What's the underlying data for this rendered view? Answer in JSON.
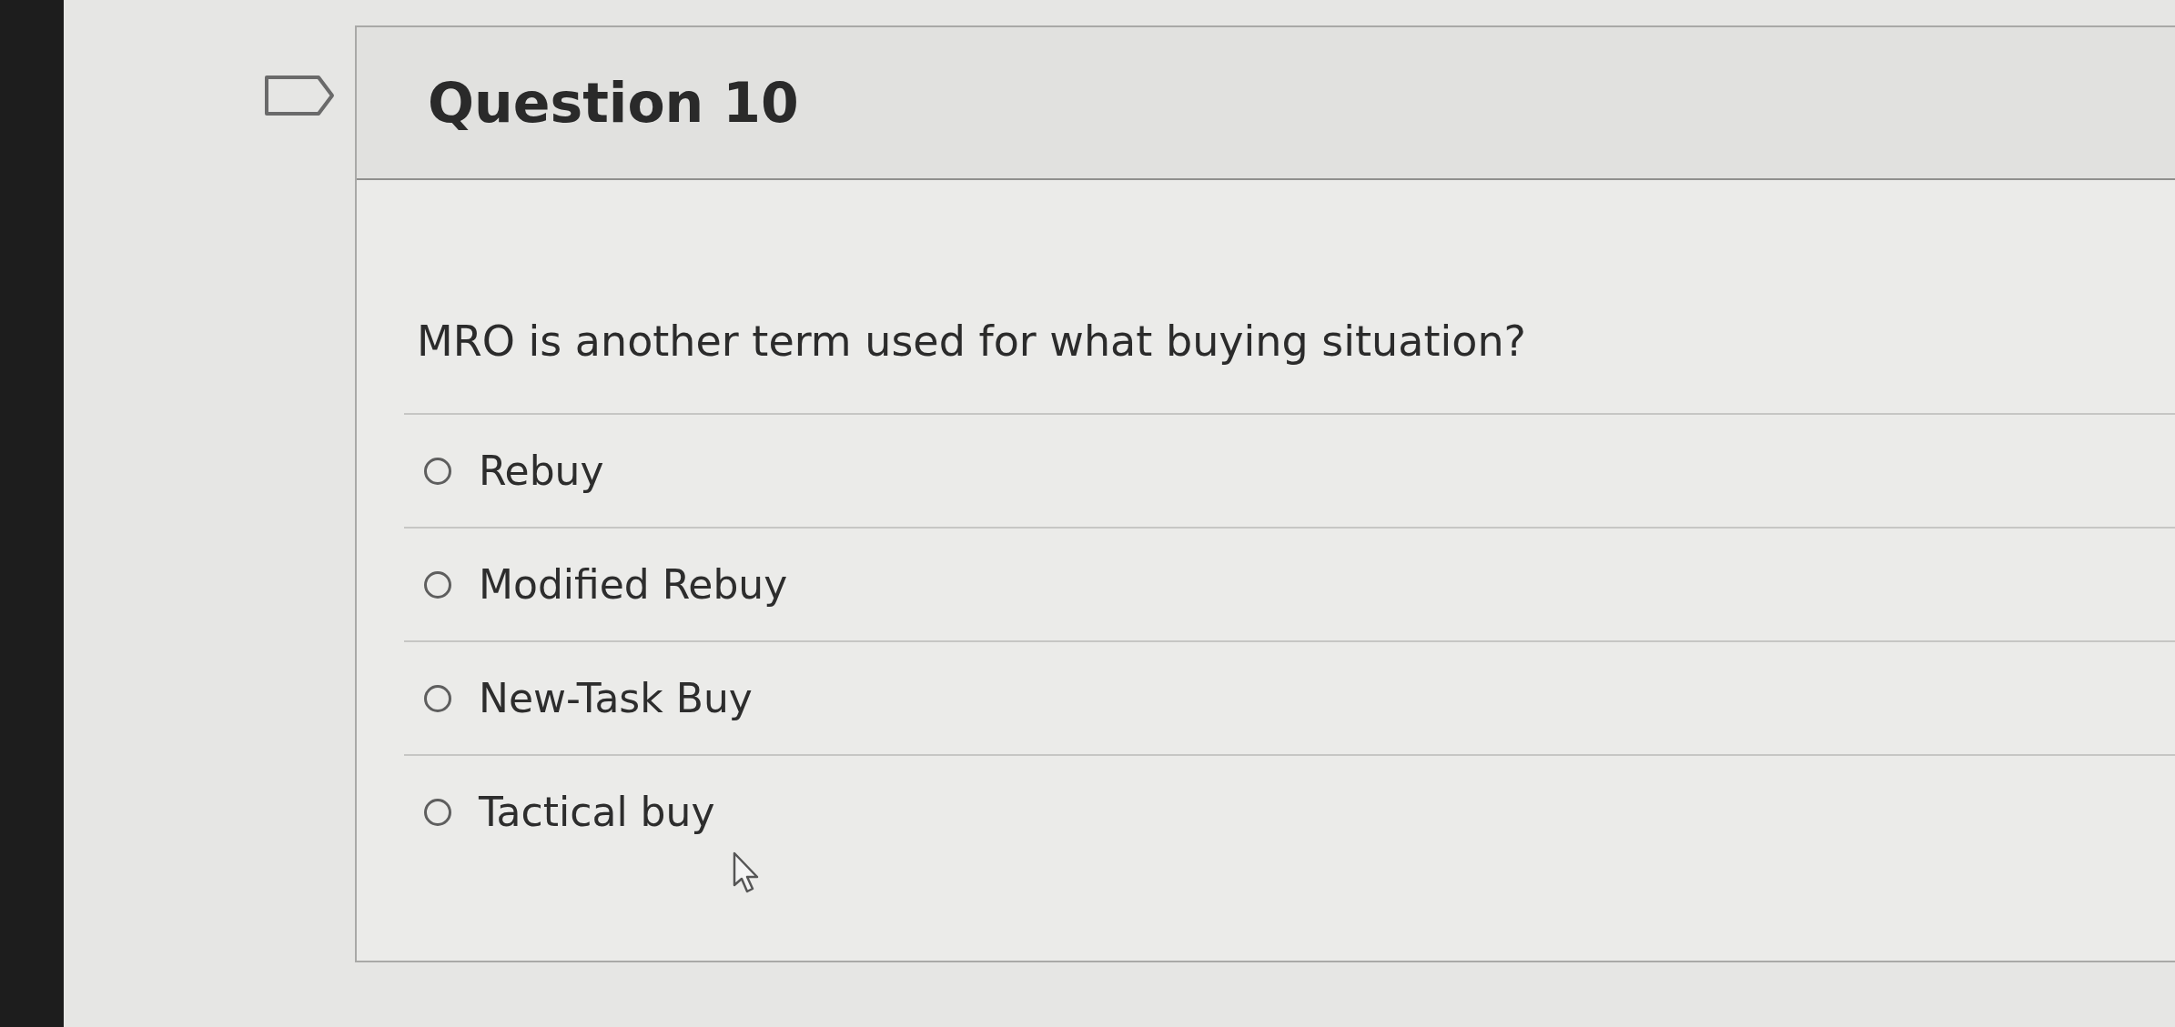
{
  "question": {
    "flagged": false,
    "title": "Question 10",
    "prompt": "MRO is another term used for what buying situation?",
    "options": [
      {
        "label": "Rebuy",
        "selected": false
      },
      {
        "label": "Modified Rebuy",
        "selected": false
      },
      {
        "label": "New-Task Buy",
        "selected": false
      },
      {
        "label": "Tactical buy",
        "selected": false
      }
    ]
  }
}
